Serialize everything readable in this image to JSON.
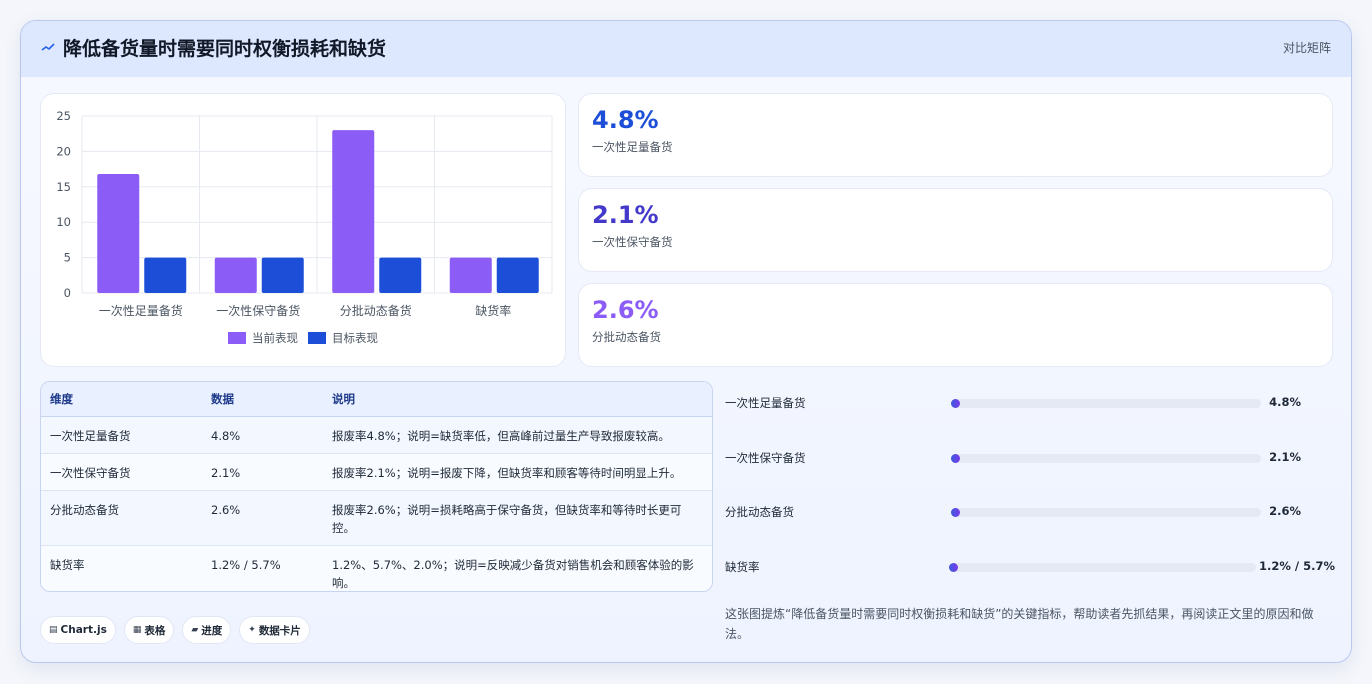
{
  "header": {
    "icon": "sparkline-icon",
    "title": "降低备货量时需要同时权衡损耗和缺货",
    "link": "对比矩阵"
  },
  "colors": {
    "current": "#8b5cf6",
    "target": "#1d4ed8",
    "stat1": "#1d4ed8",
    "stat2": "#4338ca",
    "stat3": "#8b5cf6"
  },
  "chart_data": {
    "type": "bar",
    "categories": [
      "一次性足量备货",
      "一次性保守备货",
      "分批动态备货",
      "缺货率"
    ],
    "series": [
      {
        "name": "当前表现",
        "values": [
          16.8,
          5,
          23,
          5
        ]
      },
      {
        "name": "目标表现",
        "values": [
          5,
          5,
          5,
          5
        ]
      }
    ],
    "y_ticks": [
      "0",
      "5",
      "10",
      "15",
      "20",
      "25"
    ],
    "ylim": [
      0,
      25
    ],
    "grid": true,
    "legend": "bottom"
  },
  "stats": [
    {
      "value": "4.8%",
      "label": "一次性足量备货"
    },
    {
      "value": "2.1%",
      "label": "一次性保守备货"
    },
    {
      "value": "2.6%",
      "label": "分批动态备货"
    }
  ],
  "table": {
    "headers": [
      "维度",
      "数据",
      "说明"
    ],
    "rows": [
      [
        "一次性足量备货",
        "4.8%",
        "报废率4.8%；说明=缺货率低，但高峰前过量生产导致报废较高。"
      ],
      [
        "一次性保守备货",
        "2.1%",
        "报废率2.1%；说明=报废下降，但缺货率和顾客等待时间明显上升。"
      ],
      [
        "分批动态备货",
        "2.6%",
        "报废率2.6%；说明=损耗略高于保守备货，但缺货率和等待时长更可控。"
      ],
      [
        "缺货率",
        "1.2% / 5.7%",
        "1.2%、5.7%、2.0%；说明=反映减少备货对销售机会和顾客体验的影响。"
      ]
    ]
  },
  "progress": [
    {
      "label": "一次性足量备货",
      "value": "4.8%",
      "fill": 0.02
    },
    {
      "label": "一次性保守备货",
      "value": "2.1%",
      "fill": 0.02
    },
    {
      "label": "分批动态备货",
      "value": "2.6%",
      "fill": 0.02
    },
    {
      "label": "缺货率",
      "value": "1.2% / 5.7%",
      "fill": 0.02
    }
  ],
  "chips": [
    {
      "icon": "chart-icon",
      "glyph": "▤",
      "label": "Chart.js"
    },
    {
      "icon": "table-icon",
      "glyph": "▦",
      "label": "表格"
    },
    {
      "icon": "progress-icon",
      "glyph": "▰",
      "label": "进度"
    },
    {
      "icon": "data-card-icon",
      "glyph": "✦",
      "label": "数据卡片"
    }
  ],
  "caption": "这张图提炼“降低备货量时需要同时权衡损耗和缺货”的关键指标，帮助读者先抓结果，再阅读正文里的原因和做法。"
}
